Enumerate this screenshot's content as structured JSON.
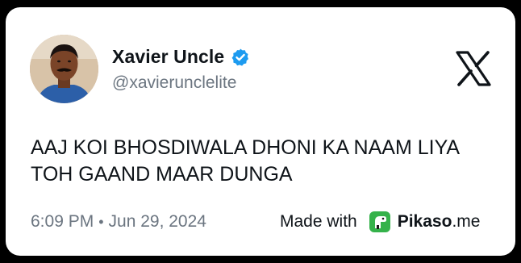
{
  "user": {
    "display_name": "Xavier Uncle",
    "handle": "@xavierunclelite",
    "verified": true,
    "avatar": "profile-photo"
  },
  "platform_logo": "x-logo-icon",
  "tweet": {
    "line1": "AAJ KOI BHOSDIWALA DHONI KA NAAM LIYA",
    "line2": "TOH GAAND MAAR DUNGA"
  },
  "meta": {
    "time": "6:09 PM",
    "separator": "•",
    "date": "Jun 29, 2024"
  },
  "branding": {
    "made_with": "Made with",
    "brand_bold": "Pikaso",
    "brand_suffix": ".me",
    "icon": "pikaso-dino-icon"
  },
  "colors": {
    "card_bg": "#ffffff",
    "page_bg": "#000000",
    "text_primary": "#0f1419",
    "text_secondary": "#6b7580",
    "verified_blue": "#1d9bf0",
    "pikaso_green": "#35b24a"
  }
}
